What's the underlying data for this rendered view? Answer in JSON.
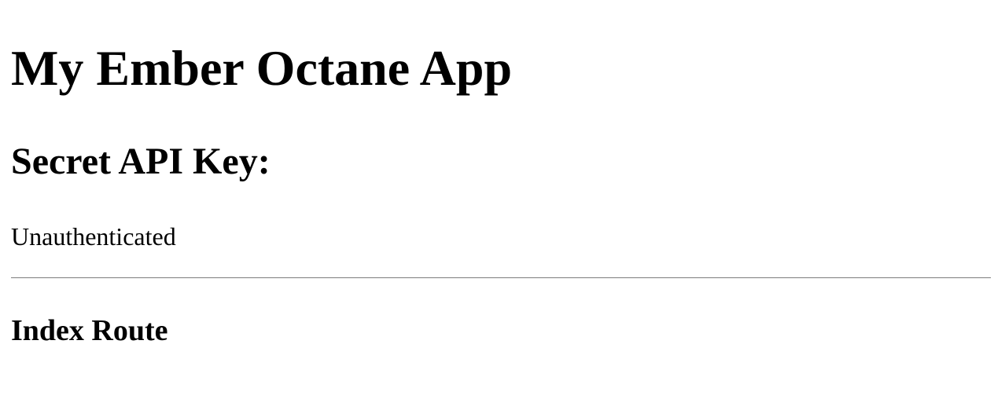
{
  "app": {
    "title": "My Ember Octane App"
  },
  "secret": {
    "heading": "Secret API Key:",
    "status": "Unauthenticated"
  },
  "route": {
    "heading": "Index Route"
  }
}
